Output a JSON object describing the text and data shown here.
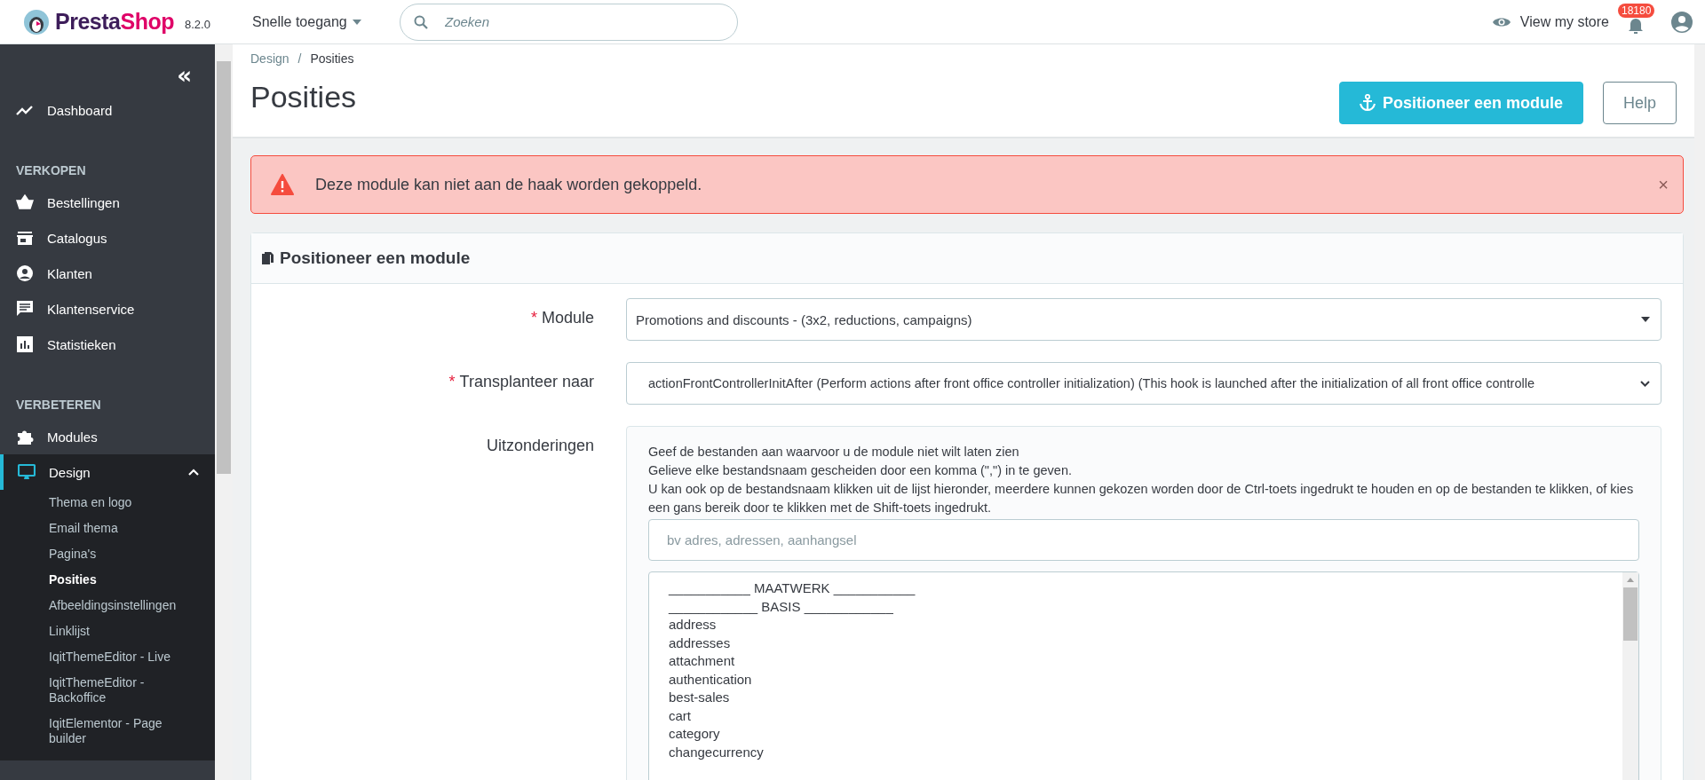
{
  "header": {
    "brand_first": "Presta",
    "brand_second": "Shop",
    "version": "8.2.0",
    "quick_access": "Snelle toegang",
    "search": {
      "placeholder": "Zoeken"
    },
    "view_store": "View my store",
    "notifications": "18180"
  },
  "sidebar": {
    "collapse": "«",
    "groups": [
      {
        "items": [
          {
            "label": "Dashboard",
            "selected": false,
            "expanded": false
          }
        ]
      },
      {
        "heading": "VERKOPEN",
        "items": [
          {
            "label": "Bestellingen",
            "selected": false,
            "expanded": false
          },
          {
            "label": "Catalogus",
            "selected": false,
            "expanded": false
          },
          {
            "label": "Klanten",
            "selected": false,
            "expanded": false
          },
          {
            "label": "Klantenservice",
            "selected": false,
            "expanded": false
          },
          {
            "label": "Statistieken",
            "selected": false,
            "expanded": false
          }
        ]
      },
      {
        "heading": "VERBETEREN",
        "items": [
          {
            "label": "Modules",
            "selected": false,
            "expanded": false
          },
          {
            "label": "Design",
            "selected": true,
            "expanded": true,
            "children": [
              {
                "label": "Thema en logo",
                "selected": false
              },
              {
                "label": "Email thema",
                "selected": false
              },
              {
                "label": "Pagina's",
                "selected": false
              },
              {
                "label": "Posities",
                "selected": true
              },
              {
                "label": "Afbeeldingsinstellingen",
                "selected": false
              },
              {
                "label": "Linklijst",
                "selected": false
              },
              {
                "label": "IqitThemeEditor - Live",
                "selected": false
              },
              {
                "label": "IqitThemeEditor - Backoffice",
                "selected": false
              },
              {
                "label": "IqitElementor - Page builder",
                "selected": false
              }
            ]
          }
        ]
      }
    ]
  },
  "breadcrumb": [
    "Design",
    "Posities"
  ],
  "breadcrumb_separator": "/",
  "page_title": "Posities",
  "toolbar": [
    {
      "label": "Positioneer een module",
      "kind": "primary"
    },
    {
      "label": "Help",
      "kind": "outline"
    }
  ],
  "alert": {
    "message": "Deze module kan niet aan de haak worden gekoppeld.",
    "close": "×"
  },
  "card": {
    "title": "Positioneer een module",
    "required_mark": "*",
    "fields": [
      {
        "label": "Module",
        "required": true,
        "kind": "select",
        "value": "Promotions and discounts - (3x2, reductions, campaigns)"
      },
      {
        "label": "Transplanteer naar",
        "required": true,
        "kind": "select",
        "value": "actionFrontControllerInitAfter (Perform actions after front office controller initialization) (This hook is launched after the initialization of all front office controlle"
      },
      {
        "label": "Uitzonderingen",
        "required": false,
        "kind": "exceptions",
        "help": [
          "Geef de bestanden aan waarvoor u de module niet wilt laten zien",
          "Gelieve elke bestandsnaam gescheiden door een komma (\",\") in te geven.",
          "U kan ook op de bestandsnaam klikken uit de lijst hieronder, meerdere kunnen gekozen worden door de Ctrl-toets ingedrukt te houden en op de bestanden te klikken, of kies een gans bereik door te klikken met de Shift-toets ingedrukt."
        ],
        "placeholder": "bv adres, adressen, aanhangsel",
        "options": [
          "___________ MAATWERK ___________",
          "____________ BASIS ____________",
          "address",
          "addresses",
          "attachment",
          "authentication",
          "best-sales",
          "cart",
          "category",
          "changecurrency"
        ]
      }
    ]
  }
}
